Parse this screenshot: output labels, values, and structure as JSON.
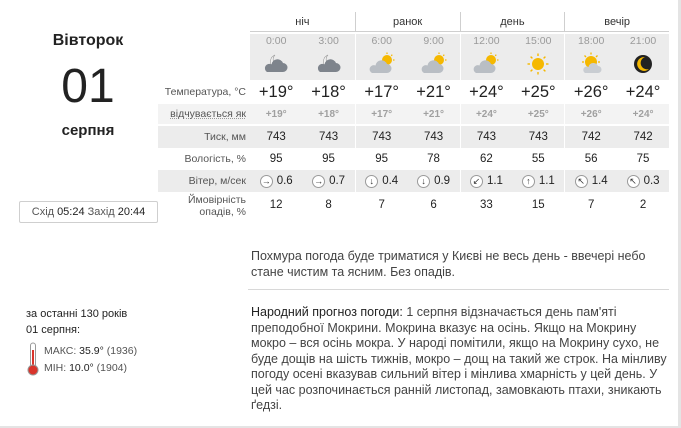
{
  "day": {
    "weekday": "Вівторок",
    "number": "01",
    "month": "серпня",
    "sunrise_label": "Схід",
    "sunrise": "05:24",
    "sunset_label": "Захід",
    "sunset": "20:44"
  },
  "periods": [
    "ніч",
    "ранок",
    "день",
    "вечір"
  ],
  "hours": [
    "0:00",
    "3:00",
    "6:00",
    "9:00",
    "12:00",
    "15:00",
    "18:00",
    "21:00"
  ],
  "icons": [
    "cloud-moon-icon",
    "cloud-moon-icon",
    "cloud-sun-icon",
    "cloud-sun-icon",
    "cloud-sun-icon",
    "sun-icon",
    "sun-cloud-icon",
    "moon-icon"
  ],
  "rows": {
    "temperature": {
      "label": "Температура, °C",
      "values": [
        "+19°",
        "+18°",
        "+17°",
        "+21°",
        "+24°",
        "+25°",
        "+26°",
        "+24°"
      ]
    },
    "feels_like": {
      "label": "відчувається як",
      "values": [
        "+19°",
        "+18°",
        "+17°",
        "+21°",
        "+24°",
        "+25°",
        "+26°",
        "+24°"
      ]
    },
    "pressure": {
      "label": "Тиск, мм",
      "values": [
        "743",
        "743",
        "743",
        "743",
        "743",
        "743",
        "742",
        "742"
      ]
    },
    "humidity": {
      "label": "Вологість, %",
      "values": [
        "95",
        "95",
        "95",
        "78",
        "62",
        "55",
        "56",
        "75"
      ]
    },
    "wind": {
      "label": "Вітер, м/сек",
      "directions": [
        "→",
        "→",
        "↓",
        "↓",
        "↙",
        "↑",
        "↖",
        "↖"
      ],
      "values": [
        "0.6",
        "0.7",
        "0.4",
        "0.9",
        "1.1",
        "1.1",
        "1.4",
        "0.3"
      ]
    },
    "precip": {
      "label_line1": "Ймовірність",
      "label_line2": "опадів, %",
      "values": [
        "12",
        "8",
        "7",
        "6",
        "33",
        "15",
        "7",
        "2"
      ]
    }
  },
  "description": "Похмура погода буде триматися у Києві не весь день - ввечері небо стане чистим та ясним. Без опадів.",
  "folk": {
    "heading": "Народний прогноз погоди:",
    "text": "1 серпня відзначається день пам'яті преподобної Мокрини. Мокрина вказує на осінь. Якщо на Мокрину мокро – вся осінь мокра. У народі помітили, якщо на Мокрину сухо, не буде дощів на шість тижнів, мокро – дощ на такий же строк. На мінливу погоду осені вказував сильний вітер і мінлива хмарність у цей день. У цей час розпочинається ранній листопад, замовкають птахи, зникають ґедзі."
  },
  "history": {
    "title": "за останні 130 років",
    "date": "01 серпня:",
    "max_label": "МАКС:",
    "max_value": "35.9°",
    "max_year": "(1936)",
    "min_label": "МІН:",
    "min_value": "10.0°",
    "min_year": "(1904)"
  },
  "colors": {
    "cloud": "#8a8f97",
    "sun": "#f5b800",
    "thermometer": "#d9342b"
  }
}
